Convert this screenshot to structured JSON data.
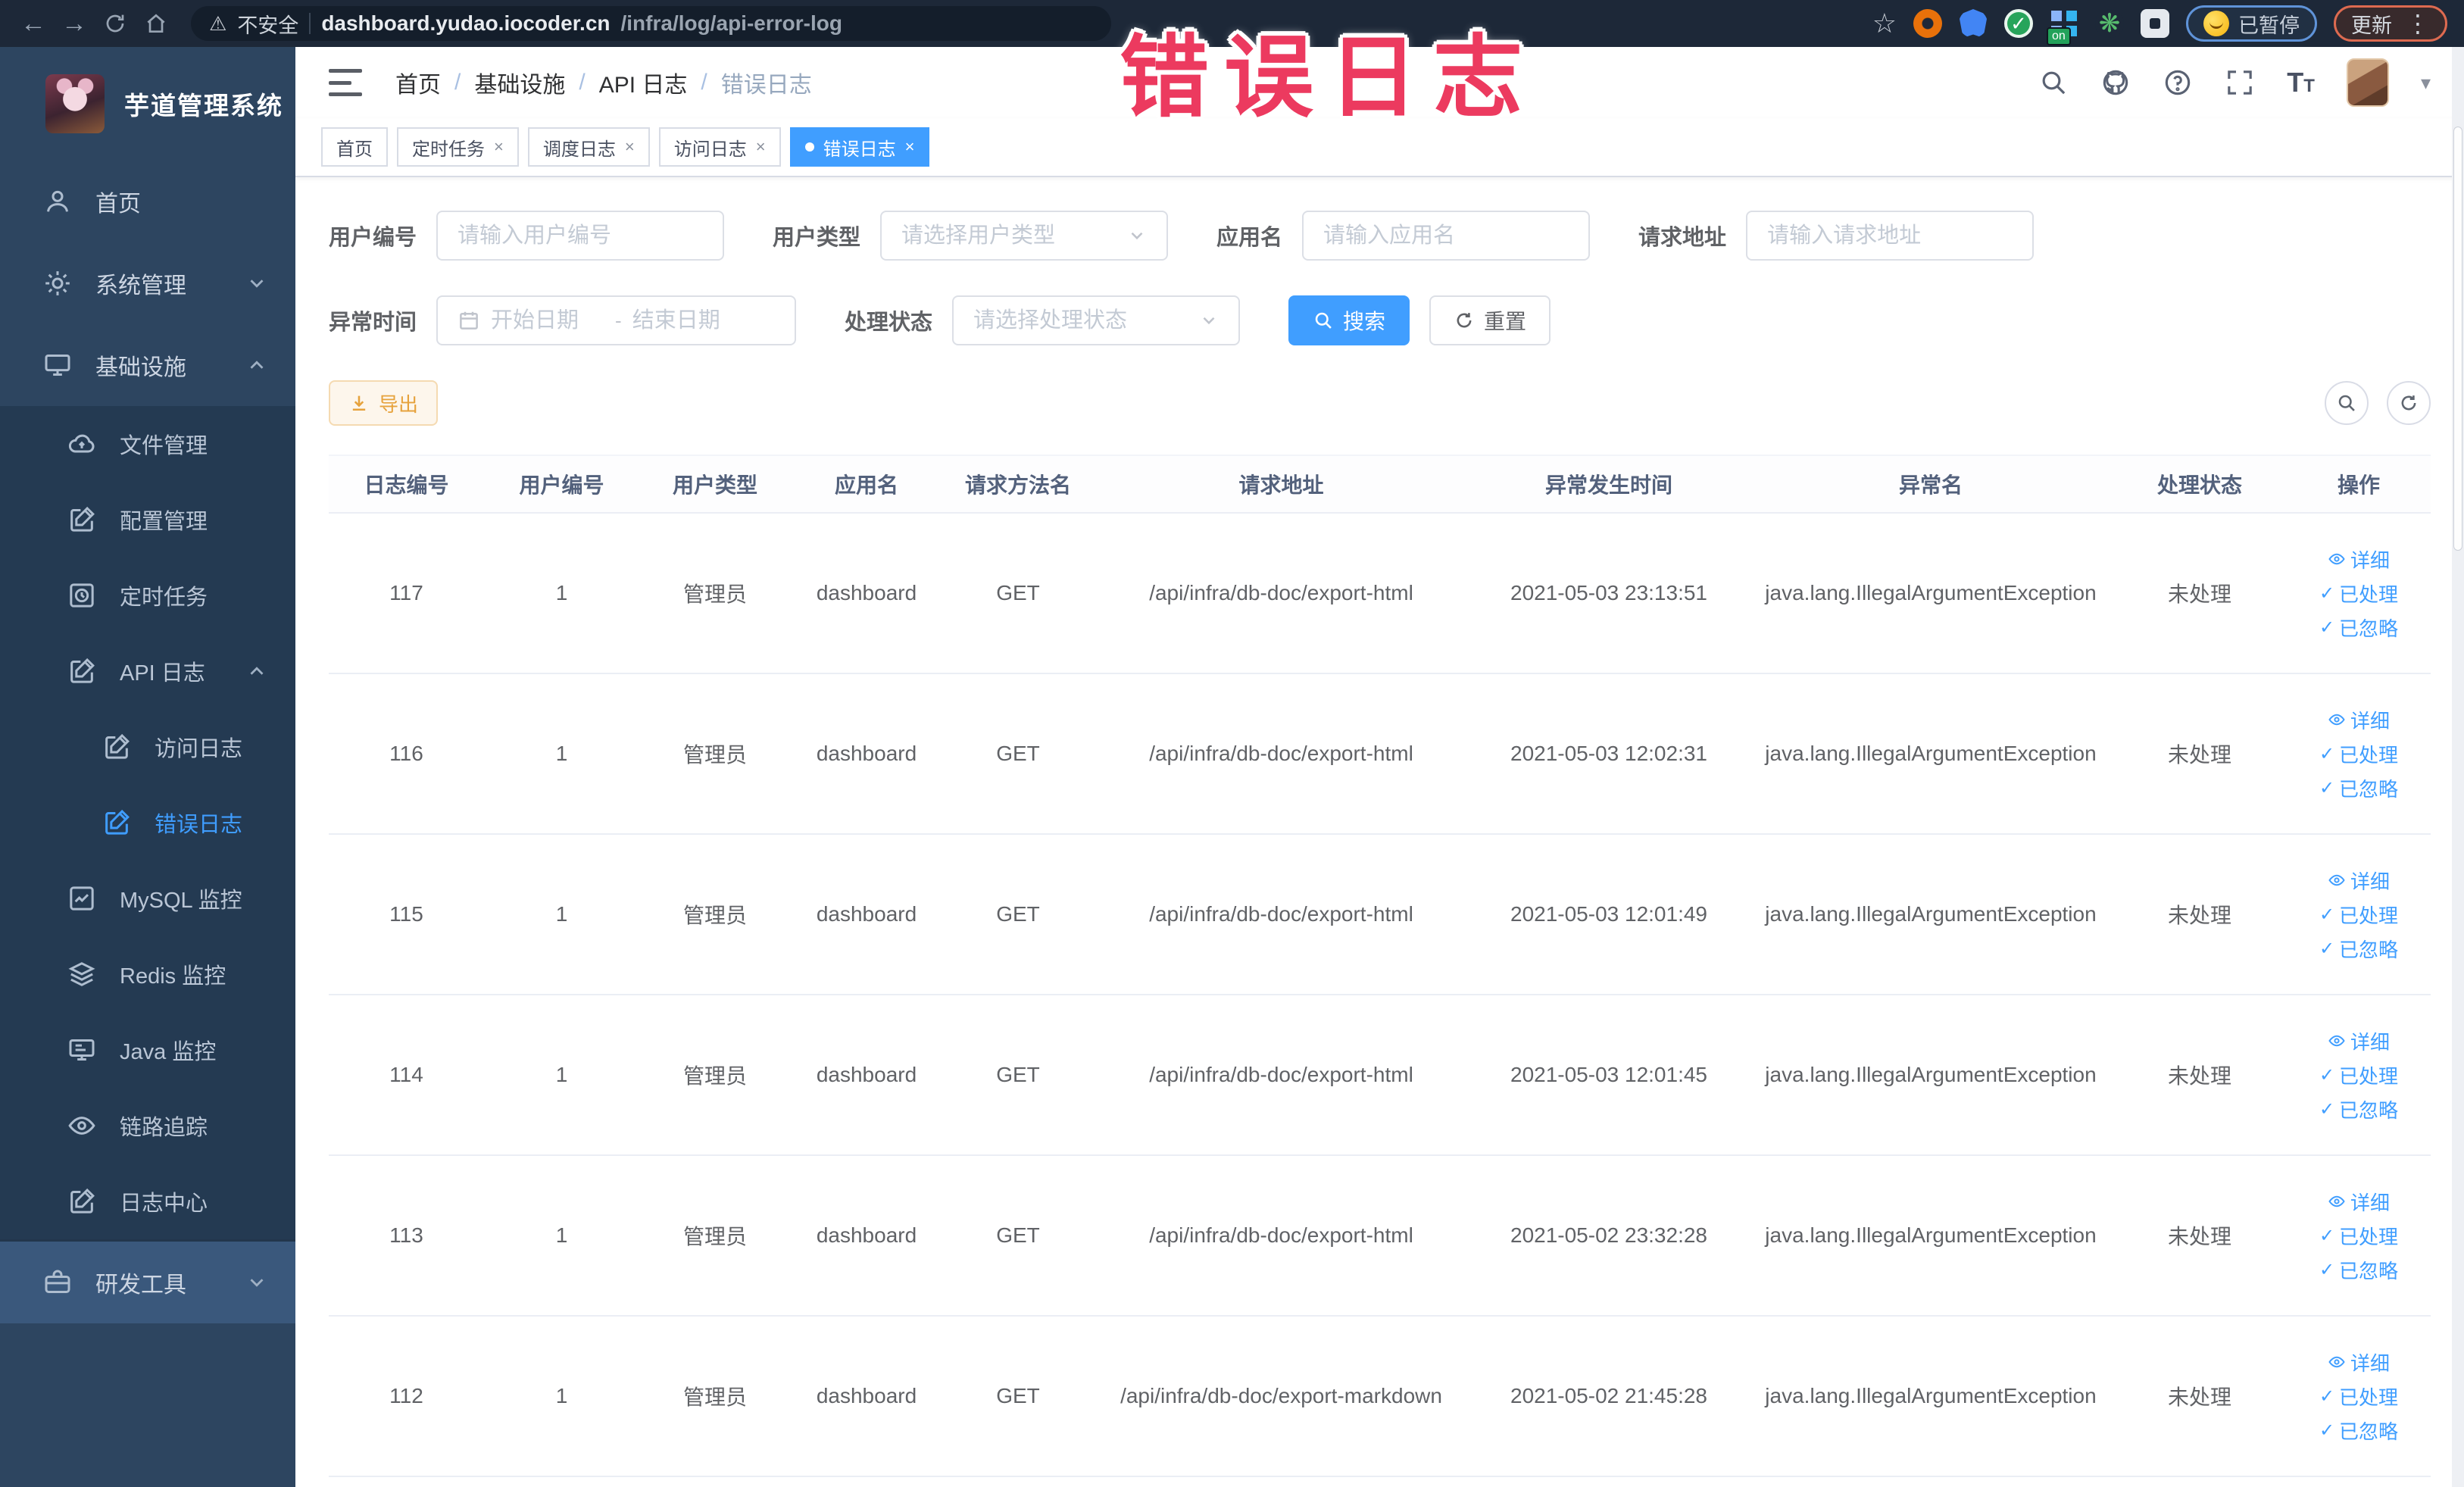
{
  "browser": {
    "security_label": "不安全",
    "url_host": "dashboard.yudao.iocoder.cn",
    "url_path": "/infra/log/api-error-log",
    "paused_badge": "已暂停",
    "update_button": "更新",
    "extension_on_badge": "on"
  },
  "overlay_title": "错误日志",
  "sidebar": {
    "app_title": "芋道管理系统",
    "items": [
      {
        "label": "首页"
      },
      {
        "label": "系统管理"
      },
      {
        "label": "基础设施"
      },
      {
        "label": "文件管理"
      },
      {
        "label": "配置管理"
      },
      {
        "label": "定时任务"
      },
      {
        "label": "API 日志"
      },
      {
        "label": "访问日志"
      },
      {
        "label": "错误日志"
      },
      {
        "label": "MySQL 监控"
      },
      {
        "label": "Redis 监控"
      },
      {
        "label": "Java 监控"
      },
      {
        "label": "链路追踪"
      },
      {
        "label": "日志中心"
      },
      {
        "label": "研发工具"
      }
    ]
  },
  "header": {
    "breadcrumb": [
      "首页",
      "基础设施",
      "API 日志",
      "错误日志"
    ]
  },
  "tabs": [
    {
      "label": "首页"
    },
    {
      "label": "定时任务"
    },
    {
      "label": "调度日志"
    },
    {
      "label": "访问日志"
    },
    {
      "label": "错误日志"
    }
  ],
  "filters": {
    "user_id_label": "用户编号",
    "user_id_placeholder": "请输入用户编号",
    "user_type_label": "用户类型",
    "user_type_placeholder": "请选择用户类型",
    "app_name_label": "应用名",
    "app_name_placeholder": "请输入应用名",
    "request_url_label": "请求地址",
    "request_url_placeholder": "请输入请求地址",
    "exception_time_label": "异常时间",
    "date_start_placeholder": "开始日期",
    "date_separator": "-",
    "date_end_placeholder": "结束日期",
    "process_status_label": "处理状态",
    "process_status_placeholder": "请选择处理状态",
    "search_button": "搜索",
    "reset_button": "重置"
  },
  "toolbar": {
    "export_button": "导出"
  },
  "table": {
    "headers": [
      "日志编号",
      "用户编号",
      "用户类型",
      "应用名",
      "请求方法名",
      "请求地址",
      "异常发生时间",
      "异常名",
      "处理状态",
      "操作"
    ],
    "action_labels": {
      "detail": "详细",
      "processed": "已处理",
      "ignored": "已忽略"
    },
    "rows": [
      {
        "id": "117",
        "user_id": "1",
        "user_type": "管理员",
        "app_name": "dashboard",
        "method": "GET",
        "url": "/api/infra/db-doc/export-html",
        "time": "2021-05-03 23:13:51",
        "exception_name": "java.lang.IllegalArgumentException",
        "status": "未处理"
      },
      {
        "id": "116",
        "user_id": "1",
        "user_type": "管理员",
        "app_name": "dashboard",
        "method": "GET",
        "url": "/api/infra/db-doc/export-html",
        "time": "2021-05-03 12:02:31",
        "exception_name": "java.lang.IllegalArgumentException",
        "status": "未处理"
      },
      {
        "id": "115",
        "user_id": "1",
        "user_type": "管理员",
        "app_name": "dashboard",
        "method": "GET",
        "url": "/api/infra/db-doc/export-html",
        "time": "2021-05-03 12:01:49",
        "exception_name": "java.lang.IllegalArgumentException",
        "status": "未处理"
      },
      {
        "id": "114",
        "user_id": "1",
        "user_type": "管理员",
        "app_name": "dashboard",
        "method": "GET",
        "url": "/api/infra/db-doc/export-html",
        "time": "2021-05-03 12:01:45",
        "exception_name": "java.lang.IllegalArgumentException",
        "status": "未处理"
      },
      {
        "id": "113",
        "user_id": "1",
        "user_type": "管理员",
        "app_name": "dashboard",
        "method": "GET",
        "url": "/api/infra/db-doc/export-html",
        "time": "2021-05-02 23:32:28",
        "exception_name": "java.lang.IllegalArgumentException",
        "status": "未处理"
      },
      {
        "id": "112",
        "user_id": "1",
        "user_type": "管理员",
        "app_name": "dashboard",
        "method": "GET",
        "url": "/api/infra/db-doc/export-markdown",
        "time": "2021-05-02 21:45:28",
        "exception_name": "java.lang.IllegalArgumentException",
        "status": "未处理"
      }
    ]
  },
  "colors": {
    "accent": "#409eff",
    "sidebar_bg": "#2d4560",
    "export_text": "#e6a23c",
    "overlay_pink": "#ec3a5f"
  }
}
